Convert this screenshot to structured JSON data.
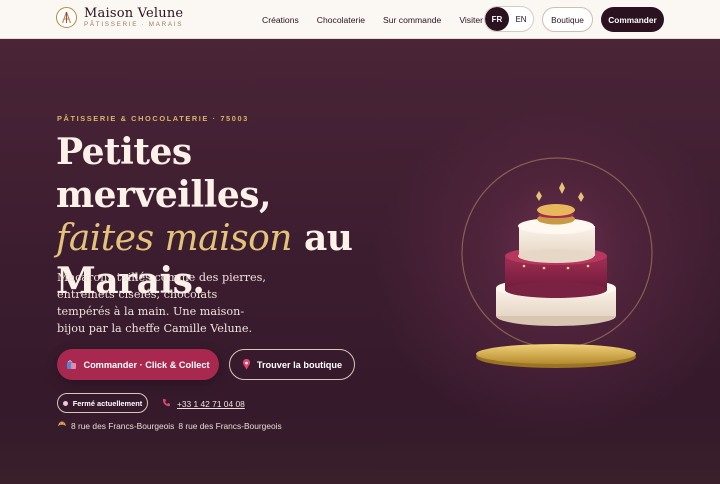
{
  "header": {
    "brand_name": "Maison Velune",
    "brand_sub": "PÂTISSERIE · MARAIS",
    "nav": [
      "Créations",
      "Chocolaterie",
      "Sur commande",
      "Visiter"
    ],
    "lang": {
      "active": "FR",
      "other": "EN"
    },
    "boutique_label": "Boutique",
    "commander_label": "Commander"
  },
  "hero": {
    "eyebrow": "PÂTISSERIE & CHOCOLATERIE · 75003",
    "title_part1": "Petites merveilles,",
    "title_accent": "faites maison",
    "title_part2": " au Marais.",
    "description": "Macarons taillés comme des pierres, entremets ciselés, chocolats tempérés à la main. Une maison-bijou par la cheffe Camille Velune.",
    "cta_primary": "Commander · Click & Collect",
    "cta_secondary": "Trouver la boutique",
    "status": "Fermé actuellement",
    "phone": "+33 1 42 71 04 08",
    "address_1": "8 rue des Francs-Bourgeois",
    "address_2": "8 rue des Francs-Bourgeois"
  },
  "icons": {
    "bag": "shopping-bag-icon",
    "pin": "map-pin-icon",
    "phone": "phone-icon",
    "pastry": "croissant-icon"
  },
  "colors": {
    "primary": "#a8284f",
    "gold": "#e4c27a",
    "dark": "#2a1220",
    "hero_bg": "#3a1c2e"
  }
}
